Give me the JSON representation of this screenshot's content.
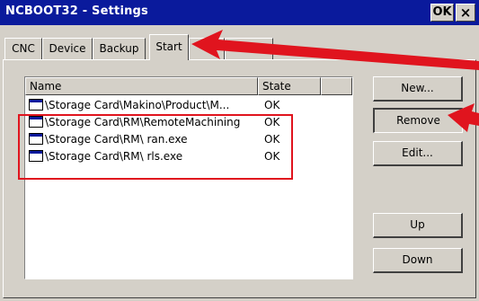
{
  "window": {
    "title": "NCBOOT32 - Settings",
    "ok_label": "OK",
    "close_label": "×"
  },
  "tabs": [
    {
      "label": "CNC"
    },
    {
      "label": "Device"
    },
    {
      "label": "Backup"
    },
    {
      "label": "Start"
    }
  ],
  "list": {
    "columns": [
      "Name",
      "State"
    ],
    "rows": [
      {
        "name": "\\Storage Card\\Makino\\Product\\M...",
        "state": "OK"
      },
      {
        "name": "\\Storage Card\\RM\\RemoteMachining",
        "state": "OK"
      },
      {
        "name": "\\Storage Card\\RM\\ ran.exe",
        "state": "OK"
      },
      {
        "name": "\\Storage Card\\RM\\ rls.exe",
        "state": "OK"
      }
    ]
  },
  "buttons": {
    "new": "New...",
    "remove": "Remove",
    "edit": "Edit...",
    "up": "Up",
    "down": "Down"
  },
  "annotation_color": "#e0141e"
}
